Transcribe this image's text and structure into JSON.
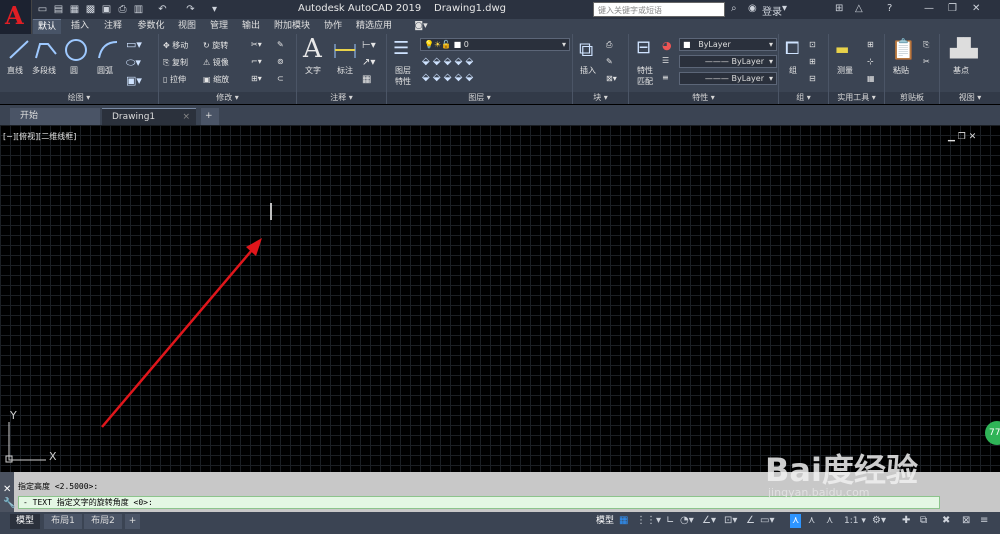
{
  "title": {
    "app_name": "Autodesk AutoCAD 2019",
    "file_name": "Drawing1.dwg",
    "search_placeholder": "键入关键字或短语",
    "login": "登录",
    "help": "?"
  },
  "menus": [
    "默认",
    "插入",
    "注释",
    "参数化",
    "视图",
    "管理",
    "输出",
    "附加模块",
    "协作",
    "精选应用"
  ],
  "active_menu": "默认",
  "ribbon": {
    "draw": {
      "line": "直线",
      "polyline": "多段线",
      "circle": "圆",
      "arc": "圆弧",
      "panel": "绘图"
    },
    "modify": {
      "move": "移动",
      "rotate": "旋转",
      "copy": "复制",
      "mirror": "镜像",
      "stretch": "拉伸",
      "scale": "缩放",
      "panel": "修改"
    },
    "annotation": {
      "text": "文字",
      "dimension": "标注",
      "panel": "注释"
    },
    "layers": {
      "layer_props": "图层",
      "layer_props2": "特性",
      "current_layer": "0",
      "panel": "图层"
    },
    "block": {
      "insert": "插入",
      "panel": "块"
    },
    "properties": {
      "match1": "特性",
      "match2": "匹配",
      "color": "ByLayer",
      "linetype": "ByLayer",
      "lineweight": "ByLayer",
      "panel": "特性"
    },
    "groups": {
      "group": "组",
      "panel": "组"
    },
    "utilities": {
      "measure": "测量",
      "panel": "实用工具"
    },
    "clipboard": {
      "paste": "粘贴",
      "panel": "剪贴板"
    },
    "view": {
      "base": "基点",
      "panel": "视图"
    }
  },
  "doc_tabs": {
    "start": "开始",
    "drawing": "Drawing1",
    "close": "×",
    "add": "+"
  },
  "viewport_label": "[−][俯视][二维线框]",
  "ucs": {
    "y": "Y",
    "x": "X"
  },
  "command": {
    "history": "指定高度 <2.5000>:",
    "prompt": "- TEXT 指定文字的旋转角度 <0>:"
  },
  "layout_tabs": [
    "模型",
    "布局1",
    "布局2"
  ],
  "layout_add": "+",
  "status": {
    "model": "模型",
    "scale": "1:1"
  },
  "badge": "77",
  "watermark": {
    "brand": "Bai度经验",
    "url": "jingyan.baidu.com"
  },
  "colors": {
    "accent": "#2e95ff",
    "arrow": "#e0161b",
    "titlebar": "#2b3240",
    "ribbon": "#3b4453"
  }
}
